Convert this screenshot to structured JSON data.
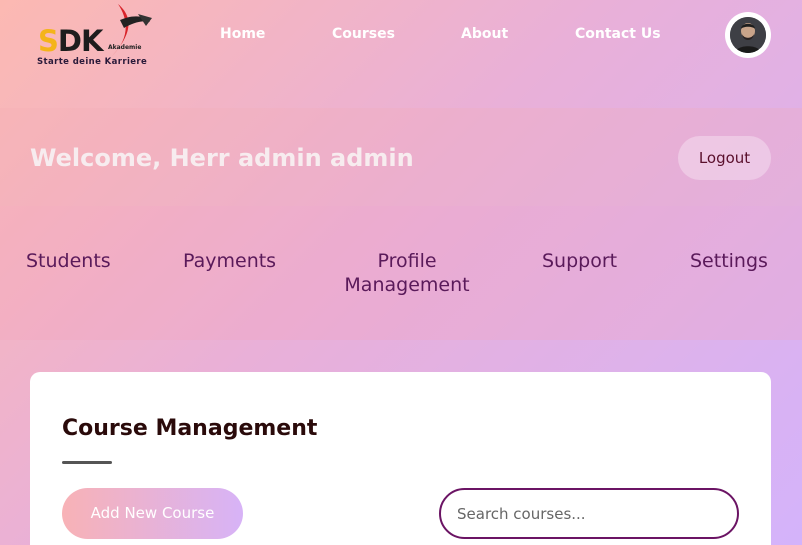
{
  "logo": {
    "brand": "SDK",
    "brand_first_letter": "S",
    "brand_rest": "DK",
    "sub": "Akademie",
    "tagline": "Starte deine Karriere"
  },
  "nav": {
    "items": [
      {
        "label": "Home"
      },
      {
        "label": "Courses"
      },
      {
        "label": "About"
      },
      {
        "label": "Contact Us"
      }
    ],
    "avatar_icon": "user-avatar-icon"
  },
  "welcome": {
    "title": "Welcome, Herr admin admin",
    "logout_label": "Logout"
  },
  "subnav": {
    "items": [
      {
        "label": "Students"
      },
      {
        "label": "Payments"
      },
      {
        "label_line1": "Profile",
        "label_line2": "Management"
      },
      {
        "label": "Support"
      },
      {
        "label": "Settings"
      }
    ]
  },
  "course_management": {
    "title": "Course Management",
    "add_button_label": "Add New Course",
    "search": {
      "placeholder": "Search courses...",
      "value": ""
    }
  },
  "colors": {
    "accent_dark": "#6b1464",
    "logo_yellow": "#f4b41a",
    "logo_red": "#d8232a"
  }
}
